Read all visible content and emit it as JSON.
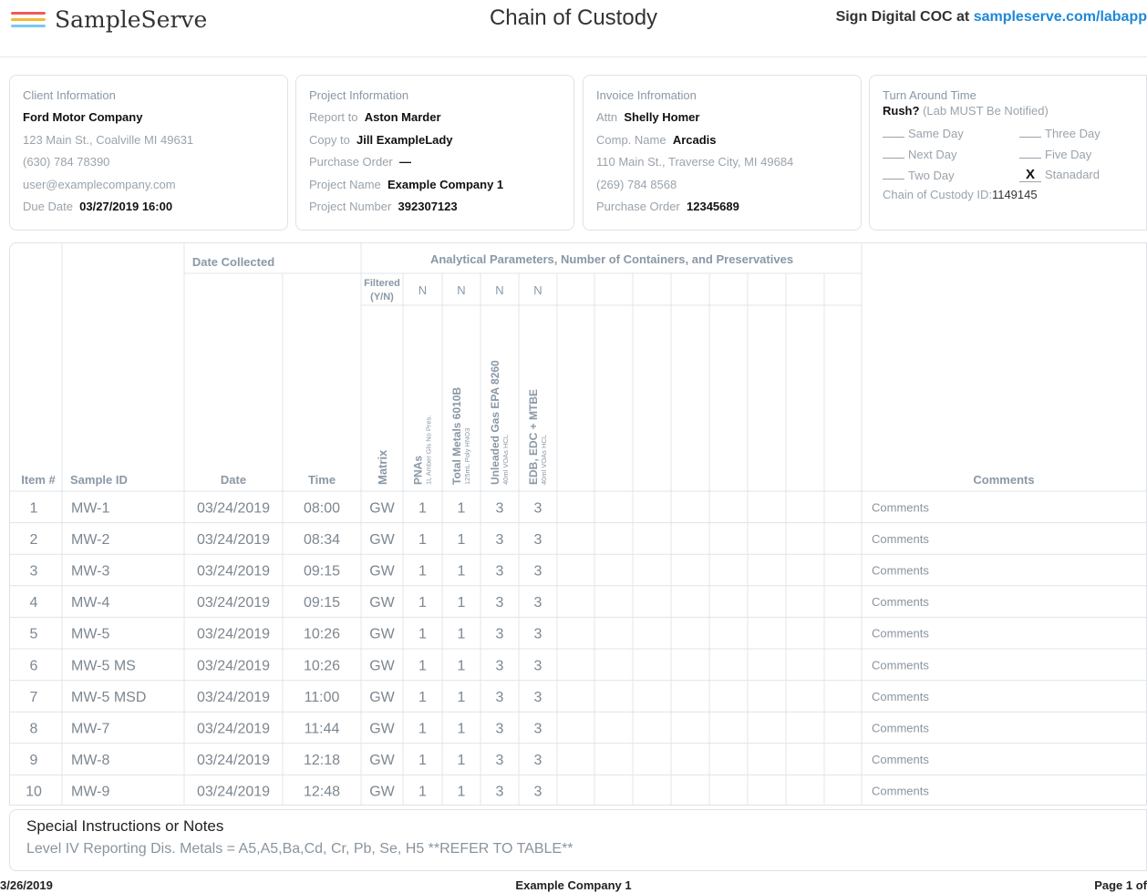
{
  "header": {
    "brand": "SampleServe",
    "title": "Chain of Custody",
    "sign_prefix": "Sign Digital COC at",
    "sign_link": "sampleserve.com/labapp",
    "logo_colors": [
      "#f05a5a",
      "#f7b733",
      "#7cc6f2"
    ]
  },
  "client": {
    "title": "Client Information",
    "name": "Ford Motor Company",
    "address": "123 Main St., Coalville MI  49631",
    "phone": "(630) 784 78390",
    "email": "user@examplecompany.com",
    "due_label": "Due Date",
    "due_value": "03/27/2019 16:00"
  },
  "project": {
    "title": "Project Information",
    "report_label": "Report to",
    "report_value": "Aston Marder",
    "copy_label": "Copy to",
    "copy_value": "Jill ExampleLady",
    "po_label": "Purchase Order",
    "po_value": "—",
    "name_label": "Project Name",
    "name_value": "Example Company 1",
    "number_label": "Project Number",
    "number_value": "392307123"
  },
  "invoice": {
    "title": "Invoice Infromation",
    "attn_label": "Attn",
    "attn_value": "Shelly Homer",
    "comp_label": "Comp. Name",
    "comp_value": "Arcadis",
    "address": "110 Main St., Traverse City, MI  49684",
    "phone": "(269) 784 8568",
    "po_label": "Purchase Order",
    "po_value": "12345689"
  },
  "tat": {
    "title": "Turn Around Time",
    "rush_label": "Rush?",
    "rush_note": "(Lab MUST Be Notified)",
    "opt_same": "Same Day",
    "opt_three": "Three Day",
    "opt_next": "Next Day",
    "opt_five": "Five Day",
    "opt_two": "Two Day",
    "opt_standard": "Stanadard",
    "selected_mark": "X",
    "coc_label": "Chain of Custody ID:",
    "coc_value": "1149145"
  },
  "table": {
    "group_date": "Date Collected",
    "group_params": "Analytical Parameters, Number of Containers, and Preservatives",
    "filtered_line1": "Filtered",
    "filtered_line2": "(Y/N)",
    "filter_flags": [
      "N",
      "N",
      "N",
      "N"
    ],
    "col_item": "Item #",
    "col_sample": "Sample ID",
    "col_date": "Date",
    "col_time": "Time",
    "col_matrix": "Matrix",
    "col_comments": "Comments",
    "params": [
      {
        "name": "PNAs",
        "sub": "1L Amber Gls No Pres."
      },
      {
        "name": "Total Metals 6010B",
        "sub": "125mL Poly HNO3"
      },
      {
        "name": "Unleaded Gas EPA 8260",
        "sub": "40ml VOAs HCL"
      },
      {
        "name": "EDB, EDC + MTBE",
        "sub": "40ml VOAs HCL"
      }
    ],
    "rows": [
      {
        "item": "1",
        "id": "MW-1",
        "date": "03/24/2019",
        "time": "08:00",
        "matrix": "GW",
        "c": [
          "1",
          "1",
          "3",
          "3"
        ],
        "comment": "Comments"
      },
      {
        "item": "2",
        "id": "MW-2",
        "date": "03/24/2019",
        "time": "08:34",
        "matrix": "GW",
        "c": [
          "1",
          "1",
          "3",
          "3"
        ],
        "comment": "Comments"
      },
      {
        "item": "3",
        "id": "MW-3",
        "date": "03/24/2019",
        "time": "09:15",
        "matrix": "GW",
        "c": [
          "1",
          "1",
          "3",
          "3"
        ],
        "comment": "Comments"
      },
      {
        "item": "4",
        "id": "MW-4",
        "date": "03/24/2019",
        "time": "09:15",
        "matrix": "GW",
        "c": [
          "1",
          "1",
          "3",
          "3"
        ],
        "comment": "Comments"
      },
      {
        "item": "5",
        "id": "MW-5",
        "date": "03/24/2019",
        "time": "10:26",
        "matrix": "GW",
        "c": [
          "1",
          "1",
          "3",
          "3"
        ],
        "comment": "Comments"
      },
      {
        "item": "6",
        "id": "MW-5 MS",
        "date": "03/24/2019",
        "time": "10:26",
        "matrix": "GW",
        "c": [
          "1",
          "1",
          "3",
          "3"
        ],
        "comment": "Comments"
      },
      {
        "item": "7",
        "id": "MW-5 MSD",
        "date": "03/24/2019",
        "time": "11:00",
        "matrix": "GW",
        "c": [
          "1",
          "1",
          "3",
          "3"
        ],
        "comment": "Comments"
      },
      {
        "item": "8",
        "id": "MW-7",
        "date": "03/24/2019",
        "time": "11:44",
        "matrix": "GW",
        "c": [
          "1",
          "1",
          "3",
          "3"
        ],
        "comment": "Comments"
      },
      {
        "item": "9",
        "id": "MW-8",
        "date": "03/24/2019",
        "time": "12:18",
        "matrix": "GW",
        "c": [
          "1",
          "1",
          "3",
          "3"
        ],
        "comment": "Comments"
      },
      {
        "item": "10",
        "id": "MW-9",
        "date": "03/24/2019",
        "time": "12:48",
        "matrix": "GW",
        "c": [
          "1",
          "1",
          "3",
          "3"
        ],
        "comment": "Comments"
      }
    ]
  },
  "notes": {
    "title": "Special Instructions or Notes",
    "text": "Level IV Reporting Dis. Metals = A5,A5,Ba,Cd, Cr, Pb, Se, H5 **REFER TO TABLE**"
  },
  "footer": {
    "date": "3/26/2019",
    "company": "Example Company 1",
    "page": "Page 1 of"
  }
}
